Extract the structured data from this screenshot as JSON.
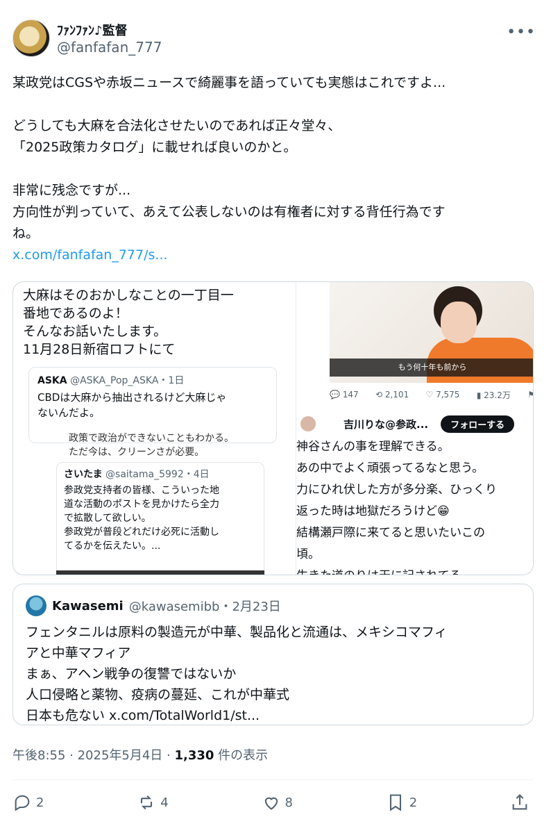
{
  "author": {
    "name": "ﾌｧﾝﾌｧﾝ♪監督",
    "handle": "@fanfafan_777"
  },
  "tweet": {
    "lines": [
      "某政党はCGSや赤坂ニュースで綺麗事を語っていても実態はこれですよ...",
      "",
      "どうしても大麻を合法化させたいのであれば正々堂々、",
      "「2025政策カタログ」に載せれば良いのかと。",
      "",
      "非常に残念ですが...",
      "方向性が判っていて、あえて公表しないのは有権者に対する背任行為です",
      "ね。"
    ],
    "link": "x.com/fanfafan_777/s..."
  },
  "media": {
    "left_top": "大麻はそのおかしなことの一丁目一\n番地であるのよ！\nそんなお話いたします。\n11月28日新宿ロフトにて",
    "card1_head_name": "ASKA",
    "card1_head_meta": "@ASKA_Pop_ASKA・1日",
    "card1_text": "CBDは大麻から抽出されるけど大麻じゃ\nないんだよ。",
    "left_bottom_top": "政策で政治ができないこともわかる。\nただ今は、クリーンさが必要。",
    "card2_head_name": "さいたま",
    "card2_head_meta": "@saitama_5992・4日",
    "card2_text": "参政党支持者の皆様、こういった地\n道な活動のポストを見かけたら全力\nで拡散して欲しい。\n参政党が普段どれだけ必死に活動し\nてるかを伝えたい。...",
    "video_caption": "もう何十年も前から",
    "stats": [
      "147",
      "2,101",
      "7,575",
      "23.2万"
    ],
    "user_name": "吉川りな@参政...",
    "follow_label": "フォローする",
    "right_text": "神谷さんの事を理解できる。\nあの中でよく頑張ってるなと思う。\n力にひれ伏した方が多分楽、ひっくり\n返った時は地獄だろうけど😁\n結構瀬戸際に来てると思いたいこの\n頃。\n生きた道のりは天に記されてる"
  },
  "quote": {
    "name": "Kawasemi",
    "meta": "@kawasemibb・2月23日",
    "text": "フェンタニルは原料の製造元が中華、製品化と流通は、メキシコマフィ\nアと中華マフィア\nまぁ、アヘン戦争の復讐ではないか\n人口侵略と薬物、疫病の蔓延、これが中華式\n日本も危ない x.com/TotalWorld1/st..."
  },
  "meta": {
    "time": "午後8:55 · 2025年5月4日 · ",
    "views": "1,330",
    "views_suffix": " 件の表示"
  },
  "actions": {
    "replies": "2",
    "reposts": "4",
    "likes": "8",
    "bookmarks": "2"
  }
}
